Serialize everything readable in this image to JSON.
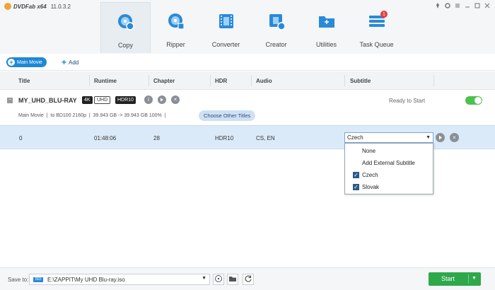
{
  "app": {
    "brand": "DVDFab x64",
    "version": "11.0.3.2"
  },
  "window_controls": [
    "pin-icon",
    "settings-icon",
    "menu-icon",
    "minimize-icon",
    "maximize-icon",
    "close-icon"
  ],
  "modules": [
    {
      "label": "Copy",
      "icon": "copy-disc-icon",
      "active": true
    },
    {
      "label": "Ripper",
      "icon": "ripper-disc-icon",
      "active": false
    },
    {
      "label": "Converter",
      "icon": "converter-film-icon",
      "active": false
    },
    {
      "label": "Creator",
      "icon": "creator-film-icon",
      "active": false
    },
    {
      "label": "Utilities",
      "icon": "utilities-folder-icon",
      "active": false
    },
    {
      "label": "Task Queue",
      "icon": "task-queue-icon",
      "active": false,
      "badge": "1"
    }
  ],
  "source": {
    "main_movie_label": "Main Movie",
    "add_label": "Add"
  },
  "table": {
    "headers": {
      "title": "Title",
      "runtime": "Runtime",
      "chapter": "Chapter",
      "hdr": "HDR",
      "audio": "Audio",
      "subtitle": "Subtitle"
    }
  },
  "disc": {
    "name": "MY_UHD_BLU-RAY",
    "tag_4k": "4K",
    "tag_uhd": "UHD",
    "tag_hdr": "HDR10",
    "status": "Ready to Start",
    "mode": "Main Movie",
    "target": "to BD100 2160p",
    "size": "39.943 GB -> 39.943 GB 100%",
    "choose_titles_label": "Choose Other Titles",
    "toggle_on": true
  },
  "title_row": {
    "title": "0",
    "runtime": "01:48:06",
    "chapter": "28",
    "hdr": "HDR10",
    "audio": "CS, EN",
    "subtitle_selected": "Czech"
  },
  "subtitle_dropdown": {
    "options": [
      {
        "label": "None",
        "checked": false
      },
      {
        "label": "Add External Subtitle",
        "checked": false
      },
      {
        "label": "Czech",
        "checked": true
      },
      {
        "label": "Slovak",
        "checked": true
      }
    ]
  },
  "bottom": {
    "save_to_label": "Save to:",
    "device_tag": "ISO",
    "path": "E:\\ZAPPIT\\My UHD Blu-ray.iso",
    "start_label": "Start"
  },
  "colors": {
    "accent_blue": "#1e88d8",
    "start_green": "#2ea84a",
    "selected_row": "#dbeaf8",
    "badge_red": "#e83b3b"
  }
}
